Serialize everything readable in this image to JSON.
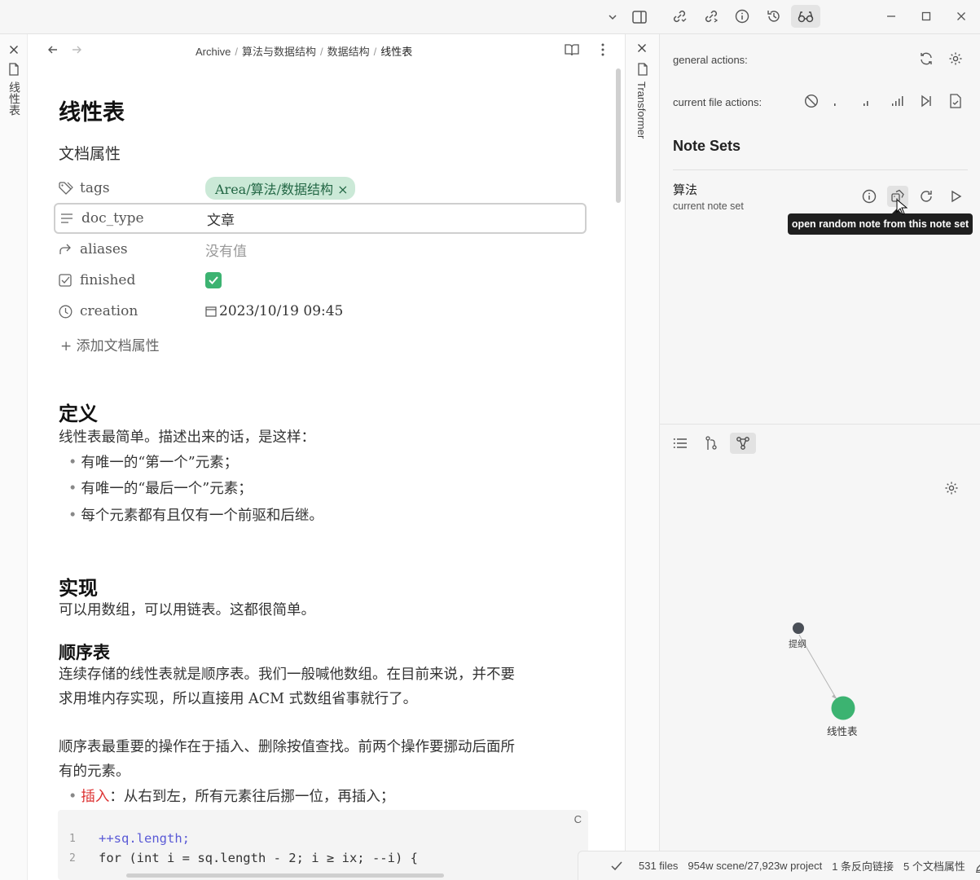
{
  "breadcrumb": [
    "Archive",
    "算法与数据结构",
    "数据结构",
    "线性表"
  ],
  "left_strip": {
    "tab_label": "线性表"
  },
  "transformer_strip": {
    "tab_label": "Transformer"
  },
  "doc": {
    "title": "线性表",
    "properties_heading": "文档属性",
    "properties": [
      {
        "key": "tags",
        "value": "Area/算法/数据结构",
        "type": "tag"
      },
      {
        "key": "doc_type",
        "value": "文章",
        "type": "text"
      },
      {
        "key": "aliases",
        "value": "没有值",
        "type": "empty"
      },
      {
        "key": "finished",
        "value": "checked",
        "type": "checkbox"
      },
      {
        "key": "creation",
        "value": "2023/10/19 09:45",
        "type": "date"
      }
    ],
    "add_property": "添加文档属性",
    "sections": {
      "def_heading": "定义",
      "def_text": "线性表最简单。描述出来的话，是这样：",
      "def_items": [
        "有唯一的“第一个”元素；",
        "有唯一的“最后一个”元素；",
        "每个元素都有且仅有一个前驱和后继。"
      ],
      "impl_heading": "实现",
      "impl_text": "可以用数组，可以用链表。这都很简单。",
      "seq_heading": "顺序表",
      "seq_p1_line1": "连续存储的线性表就是顺序表。我们一般喊他数组。在目前来说，并不要",
      "seq_p1_line2": "求用堆内存实现，所以直接用 ACM 式数组省事就行了。",
      "seq_p2_line1": "顺序表最重要的操作在于插入、删除按值查找。前两个操作要挪动后面所",
      "seq_p2_line2": "有的元素。",
      "insert_label": "插入",
      "insert_text": "：从右到左，所有元素往后挪一位，再插入；"
    },
    "code": {
      "lang_label": "C",
      "lines": [
        {
          "no": "1",
          "text": "++sq.length;"
        },
        {
          "no": "2",
          "text": "for (int i = sq.length - 2; i ≥ ix; --i) {"
        }
      ]
    }
  },
  "right_panel": {
    "general_actions": "general actions:",
    "current_file_actions": "current file actions:",
    "note_sets_heading": "Note Sets",
    "note_set": {
      "name": "算法",
      "subtitle": "current note set"
    },
    "tooltip": "open random note from this note set",
    "graph": {
      "nodes": [
        {
          "label": "提纲",
          "color": "#4a4f57"
        },
        {
          "label": "线性表",
          "color": "#3cb371"
        }
      ]
    }
  },
  "status": {
    "files": "531 files",
    "words": "954w scene/27,923w project",
    "backlinks": "1 条反向链接",
    "props": "5 个文档属性"
  },
  "colors": {
    "accent": "#3cb371",
    "tag_bg": "#cbe9d7",
    "insert_red": "#d33"
  }
}
